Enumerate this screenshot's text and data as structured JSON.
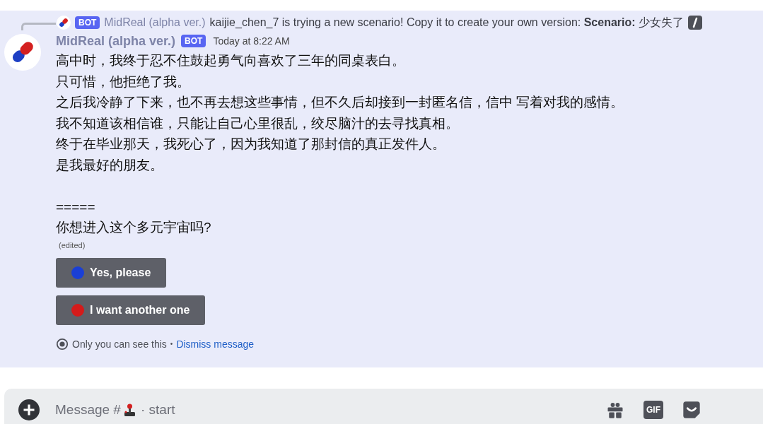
{
  "reply": {
    "badge": "BOT",
    "author": "MidReal (alpha ver.)",
    "text": "kaijie_chen_7 is trying a new scenario! Copy it to create your own version: **Scenario:** 少女失了"
  },
  "message": {
    "author": "MidReal (alpha ver.)",
    "badge": "BOT",
    "timestamp": "Today at 8:22 AM",
    "paragraphs": [
      [
        "高中时，我终于忍不住鼓起勇气向喜欢了三年的同桌表白。",
        "只可惜，他拒绝了我。",
        "之后我冷静了下来，也不再去想这些事情，但不久后却接到一封匿名信，信中 写着对我的感情。",
        "我不知道该相信谁，只能让自己心里很乱，绞尽脑汁的去寻找真相。",
        "终于在毕业那天，我死心了，因为我知道了那封信的真正发件人。",
        "是我最好的朋友。"
      ],
      [
        "=====",
        "你想进入这个多元宇宙吗?"
      ]
    ],
    "edited": "(edited)",
    "buttons": [
      {
        "label": "Yes, please",
        "color": "#1a3fd6"
      },
      {
        "label": "I want another one",
        "color": "#d41a1a"
      }
    ],
    "notice": "Only you can see this",
    "separator": "•",
    "dismiss": "Dismiss message"
  },
  "composer": {
    "placeholder_prefix": "Message #",
    "placeholder_suffix": "· start",
    "gif": "GIF"
  }
}
